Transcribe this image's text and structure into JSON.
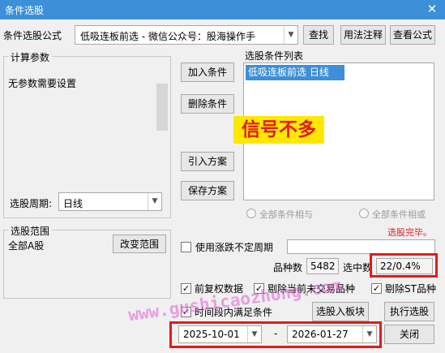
{
  "window": {
    "title": "条件选股",
    "close": "✕"
  },
  "formula": {
    "label": "条件选股公式",
    "selected": "低吸连板前选  -  微信公众号：股海操作手",
    "buttons": {
      "find": "查找",
      "usage": "用法注释",
      "view": "查看公式"
    }
  },
  "params": {
    "group_title": "计算参数",
    "text": "无参数需要设置",
    "period_label": "选股周期:",
    "period_value": "日线"
  },
  "actions": {
    "add": "加入条件",
    "delete": "删除条件",
    "import": "引入方案",
    "save": "保存方案"
  },
  "conditions": {
    "group_title": "选股条件列表",
    "items": [
      "低吸连板前选  日线"
    ],
    "overlay_note": "信号不多",
    "radio_and": "全部条件相与",
    "radio_or": "全部条件相或",
    "status": "选股完毕。"
  },
  "scope": {
    "group_title": "选股范围",
    "text": "全部A股",
    "change_button": "改变范围"
  },
  "options": {
    "irregular_label": "使用涨跌不定周期",
    "variety_label": "品种数",
    "variety_value": "5482",
    "selected_label": "选中数",
    "selected_value": "22/0.4%",
    "forward_adjust": "前复权数据",
    "exclude_untraded": "剔除当前未交易品种",
    "exclude_st": "剔除ST品种",
    "time_range": "时间段内满足条件"
  },
  "bottom": {
    "to_block": "选股入板块",
    "run": "执行选股",
    "close": "关闭",
    "date_from": "2025-10-01",
    "date_sep": "-",
    "date_to": "2026-01-27"
  },
  "watermark": "www.gushicaozhong.com",
  "colors": {
    "titlebar": "#3c8fd8",
    "selection": "#3c8fd8",
    "highlight": "#e21b1b",
    "status": "#e02020"
  }
}
